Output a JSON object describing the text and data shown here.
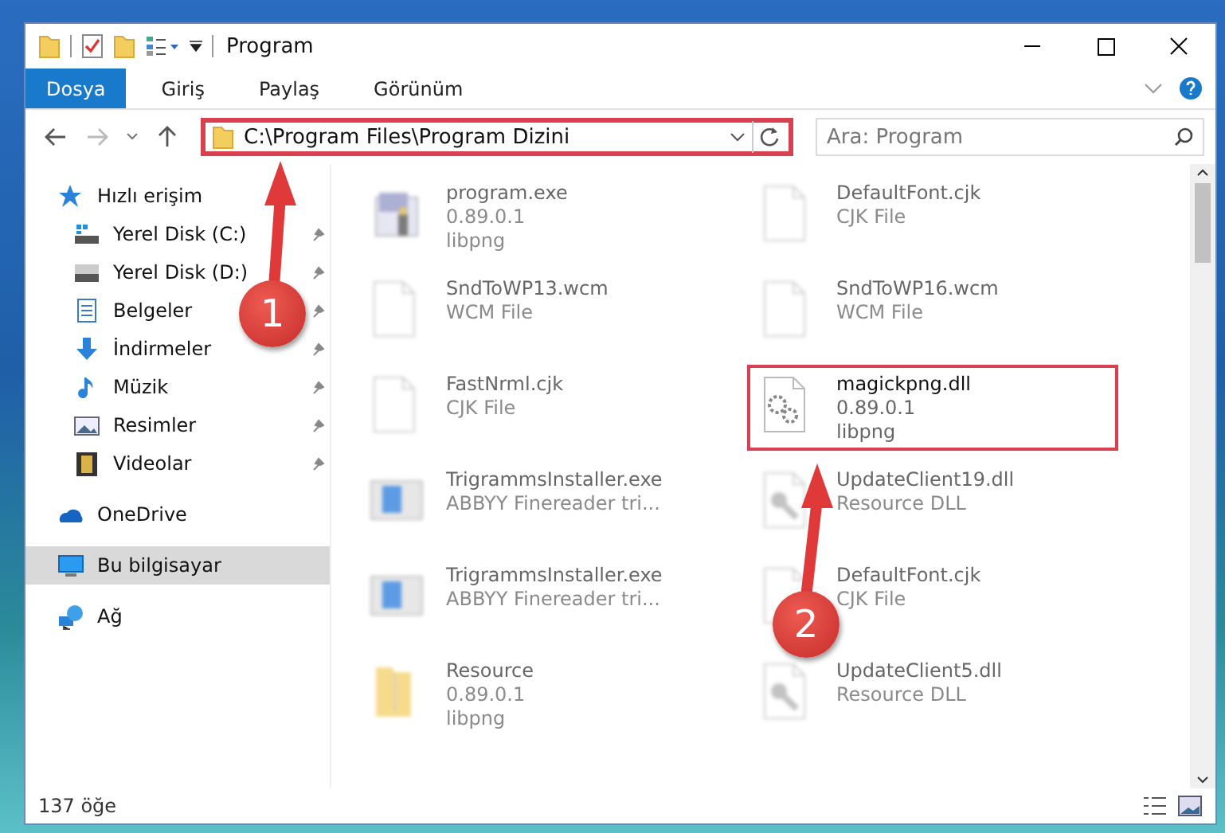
{
  "window": {
    "title": "Program"
  },
  "ribbon_tabs": [
    {
      "label": "Dosya",
      "selected": true
    },
    {
      "label": "Giriş",
      "selected": false
    },
    {
      "label": "Paylaş",
      "selected": false
    },
    {
      "label": "Görünüm",
      "selected": false
    }
  ],
  "address": {
    "path": "C:\\Program Files\\Program Dizini",
    "highlighted": true
  },
  "search": {
    "placeholder": "Ara: Program"
  },
  "sidebar": {
    "items": [
      {
        "label": "Hızlı erişim",
        "kind": "star",
        "selected": false,
        "children": [
          {
            "label": "Yerel Disk (C:)",
            "kind": "drive-windows",
            "selected": false,
            "pinned": true
          },
          {
            "label": "Yerel Disk (D:)",
            "kind": "drive",
            "selected": false,
            "pinned": true
          },
          {
            "label": "Belgeler",
            "kind": "documents",
            "selected": false,
            "pinned": true
          },
          {
            "label": "İndirmeler",
            "kind": "download",
            "selected": false,
            "pinned": true
          },
          {
            "label": "Müzik",
            "kind": "music",
            "selected": false,
            "pinned": true
          },
          {
            "label": "Resimler",
            "kind": "pictures",
            "selected": false,
            "pinned": true
          },
          {
            "label": "Videolar",
            "kind": "videos",
            "selected": false,
            "pinned": true
          }
        ]
      },
      {
        "label": "OneDrive",
        "kind": "cloud",
        "selected": false
      },
      {
        "label": "Bu bilgisayar",
        "kind": "computer",
        "selected": true
      },
      {
        "label": "Ağ",
        "kind": "network",
        "selected": false
      }
    ]
  },
  "files": [
    {
      "name": "program.exe",
      "details": [
        "0.89.0.1",
        "libpng"
      ],
      "kind": "exe",
      "blurred": true,
      "highlighted": false
    },
    {
      "name": "DefaultFont.cjk",
      "details": [
        "CJK File"
      ],
      "kind": "blank",
      "blurred": true,
      "highlighted": false
    },
    {
      "name": "SndToWP13.wcm",
      "details": [
        "WCM File"
      ],
      "kind": "blank",
      "blurred": true,
      "highlighted": false
    },
    {
      "name": "SndToWP16.wcm",
      "details": [
        "WCM File"
      ],
      "kind": "blank",
      "blurred": true,
      "highlighted": false
    },
    {
      "name": "FastNrml.cjk",
      "details": [
        "CJK File"
      ],
      "kind": "blank",
      "blurred": true,
      "highlighted": false
    },
    {
      "name": "magickpng.dll",
      "details": [
        "0.89.0.1",
        "libpng"
      ],
      "kind": "dll",
      "blurred": false,
      "highlighted": true
    },
    {
      "name": "TrigrammsInstaller.exe",
      "details": [
        "ABBYY Finereader tri..."
      ],
      "kind": "installer",
      "blurred": true,
      "highlighted": false
    },
    {
      "name": "UpdateClient19.dll",
      "details": [
        "Resource DLL"
      ],
      "kind": "resource",
      "blurred": true,
      "highlighted": false
    },
    {
      "name": "TrigrammsInstaller.exe",
      "details": [
        "ABBYY Finereader tri..."
      ],
      "kind": "installer",
      "blurred": true,
      "highlighted": false
    },
    {
      "name": "DefaultFont.cjk",
      "details": [
        "CJK File"
      ],
      "kind": "blank",
      "blurred": true,
      "highlighted": false
    },
    {
      "name": "Resource",
      "details": [
        "0.89.0.1",
        "libpng"
      ],
      "kind": "archive",
      "blurred": true,
      "highlighted": false
    },
    {
      "name": "UpdateClient5.dll",
      "details": [
        "Resource DLL"
      ],
      "kind": "resource",
      "blurred": true,
      "highlighted": false
    }
  ],
  "status_bar": {
    "item_count": "137 öğe"
  },
  "annotations": [
    {
      "number": "1"
    },
    {
      "number": "2"
    }
  ]
}
